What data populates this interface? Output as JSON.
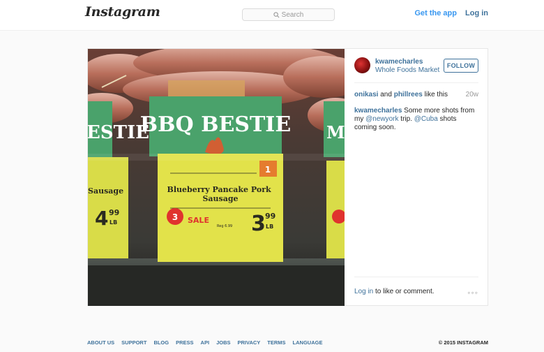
{
  "header": {
    "logo": "Instagram",
    "search_placeholder": "Search",
    "get_app": "Get the app",
    "login": "Log in"
  },
  "post": {
    "username": "kwamecharles",
    "location": "Whole Foods Market",
    "follow_label": "FOLLOW",
    "likes": {
      "user1": "onikasi",
      "joiner": "and",
      "user2": "phillrees",
      "suffix": "like this"
    },
    "time": "20w",
    "caption": {
      "user": "kwamecharles",
      "text1": "Some more shots from my",
      "mention1": "@newyork",
      "text2": "trip.",
      "mention2": "@Cuba",
      "text3": "shots coming soon."
    },
    "login_prompt": {
      "link": "Log in",
      "rest": "to like or comment."
    },
    "more": "◦◦◦",
    "photo": {
      "sign_text": "BBQ BESTIE",
      "left_sign": "ESTIE",
      "right_sign": "MA",
      "product": "Blueberry Pancake Pork Sausage",
      "left_product": "Sausage",
      "price_whole": "3",
      "price_cents": "99",
      "price_unit": "LB",
      "left_price_whole": "4",
      "left_price_cents": "99",
      "left_price_unit": "LB",
      "sale": "SALE",
      "reg": "Reg 6.99",
      "badge": "3",
      "tag_num": "1"
    }
  },
  "footer": {
    "links": [
      "ABOUT US",
      "SUPPORT",
      "BLOG",
      "PRESS",
      "API",
      "JOBS",
      "PRIVACY",
      "TERMS",
      "LANGUAGE"
    ],
    "copyright": "© 2015 INSTAGRAM"
  },
  "colors": {
    "link": "#3f729b",
    "app_link": "#3897f0",
    "sign_green": "#4aa26b",
    "tag_yellow": "#e2e24a",
    "sale_red": "#e0322e"
  }
}
